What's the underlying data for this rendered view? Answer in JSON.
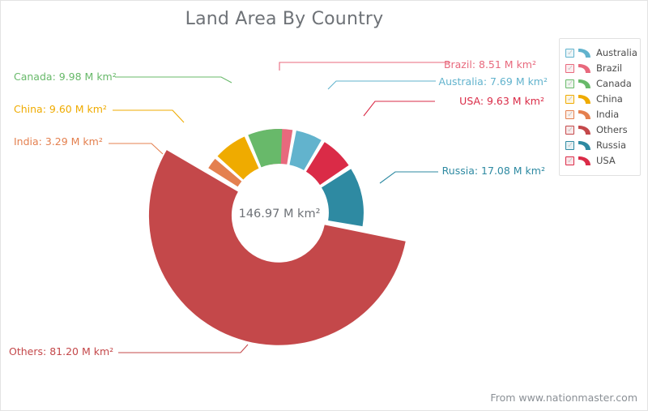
{
  "chart_data": {
    "type": "pie",
    "variant": "exploded-donut",
    "title": "Land Area By Country",
    "unit": "M km²",
    "center_total_label": "146.97 M km²",
    "center_total_value": 146.97,
    "xlabel": "",
    "ylabel": "",
    "legend_position": "right",
    "grid": false,
    "categories": [
      "Brazil",
      "Australia",
      "USA",
      "Russia",
      "Others",
      "India",
      "China",
      "Canada"
    ],
    "values": [
      8.51,
      7.69,
      9.63,
      17.08,
      81.2,
      3.29,
      9.6,
      9.98
    ],
    "slices": [
      {
        "name": "Brazil",
        "value": 8.51,
        "label": "Brazil: 8.51 M km²",
        "color": "#e8697d",
        "start_angle": -11.5,
        "end_angle": 9.3,
        "radius_scale": "small",
        "label_side": "right"
      },
      {
        "name": "Australia",
        "value": 7.69,
        "label": "Australia: 7.69 M km²",
        "color": "#62b3cd",
        "start_angle": 11.3,
        "end_angle": 30.1,
        "radius_scale": "small",
        "label_side": "right"
      },
      {
        "name": "USA",
        "value": 9.63,
        "label": "USA: 9.63 M km²",
        "color": "#da2b47",
        "start_angle": 32.1,
        "end_angle": 55.7,
        "radius_scale": "small",
        "label_side": "right"
      },
      {
        "name": "Russia",
        "value": 17.08,
        "label": "Russia: 17.08 M km²",
        "color": "#2e8aa2",
        "start_angle": 57.7,
        "end_angle": 99.5,
        "radius_scale": "small",
        "label_side": "right"
      },
      {
        "name": "Others",
        "value": 81.2,
        "label": "Others: 81.20 M km²",
        "color": "#c4484a",
        "start_angle": 101.5,
        "end_angle": 300.3,
        "radius_scale": "large",
        "label_side": "left"
      },
      {
        "name": "India",
        "value": 3.29,
        "label": "India: 3.29 M km²",
        "color": "#e4804f",
        "start_angle": 302.3,
        "end_angle": 310.3,
        "radius_scale": "small",
        "label_side": "left"
      },
      {
        "name": "China",
        "value": 9.6,
        "label": "China: 9.60 M km²",
        "color": "#efab00",
        "start_angle": 312.3,
        "end_angle": 335.8,
        "radius_scale": "small",
        "label_side": "left"
      },
      {
        "name": "Canada",
        "value": 9.98,
        "label": "Canada: 9.98 M km²",
        "color": "#68b96a",
        "start_angle": 337.8,
        "end_angle": 362.2,
        "radius_scale": "small",
        "label_side": "left"
      }
    ]
  },
  "legend": {
    "items": [
      {
        "label": "Australia",
        "color": "#62b3cd",
        "checked": true,
        "icon": "checkbox-icon"
      },
      {
        "label": "Brazil",
        "color": "#e8697d",
        "checked": true,
        "icon": "checkbox-icon"
      },
      {
        "label": "Canada",
        "color": "#68b96a",
        "checked": true,
        "icon": "checkbox-icon"
      },
      {
        "label": "China",
        "color": "#efab00",
        "checked": true,
        "icon": "checkbox-icon"
      },
      {
        "label": "India",
        "color": "#e4804f",
        "checked": true,
        "icon": "checkbox-icon"
      },
      {
        "label": "Others",
        "color": "#c4484a",
        "checked": true,
        "icon": "checkbox-icon"
      },
      {
        "label": "Russia",
        "color": "#2e8aa2",
        "checked": true,
        "icon": "checkbox-icon"
      },
      {
        "label": "USA",
        "color": "#da2b47",
        "checked": true,
        "icon": "checkbox-icon"
      }
    ],
    "check_glyph": "✓"
  },
  "footer": {
    "credit": "From www.nationmaster.com"
  },
  "colors": {
    "title": "#6e7277",
    "background": "#ffffff",
    "footer": "#8b9096",
    "legend_text": "#4c4c4c"
  }
}
